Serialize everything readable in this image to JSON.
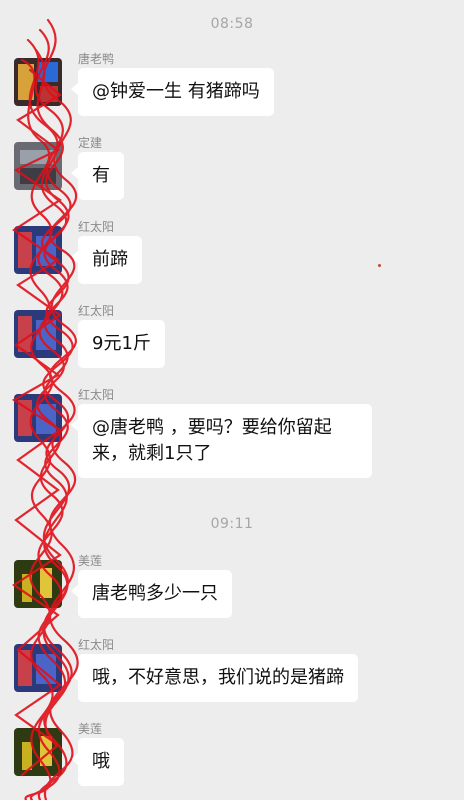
{
  "timestamps": [
    "08:58",
    "09:11"
  ],
  "messages": [
    {
      "sender": "唐老鸭",
      "text": "@钟爱一生 有猪蹄吗",
      "avatar": "avatar-tang"
    },
    {
      "sender": "定建",
      "text": "有",
      "avatar": "avatar-dingjian"
    },
    {
      "sender": "红太阳",
      "text": "前蹄",
      "avatar": "avatar-hongtaiyang"
    },
    {
      "sender": "红太阳",
      "text": "9元1斤",
      "avatar": "avatar-hongtaiyang"
    },
    {
      "sender": "红太阳",
      "text": "@唐老鸭 ，要吗？要给你留起来，就剩1只了",
      "avatar": "avatar-hongtaiyang"
    },
    {
      "sender": "美莲",
      "text": "唐老鸭多少一只",
      "avatar": "avatar-meilian"
    },
    {
      "sender": "红太阳",
      "text": "哦，不好意思，我们说的是猪蹄",
      "avatar": "avatar-hongtaiyang"
    },
    {
      "sender": "美莲",
      "text": "哦",
      "avatar": "avatar-meilian"
    }
  ],
  "colors": {
    "background": "#ededed",
    "bubble": "#ffffff",
    "scribble": "#e0101a",
    "timestamp": "#a6a6a6"
  }
}
